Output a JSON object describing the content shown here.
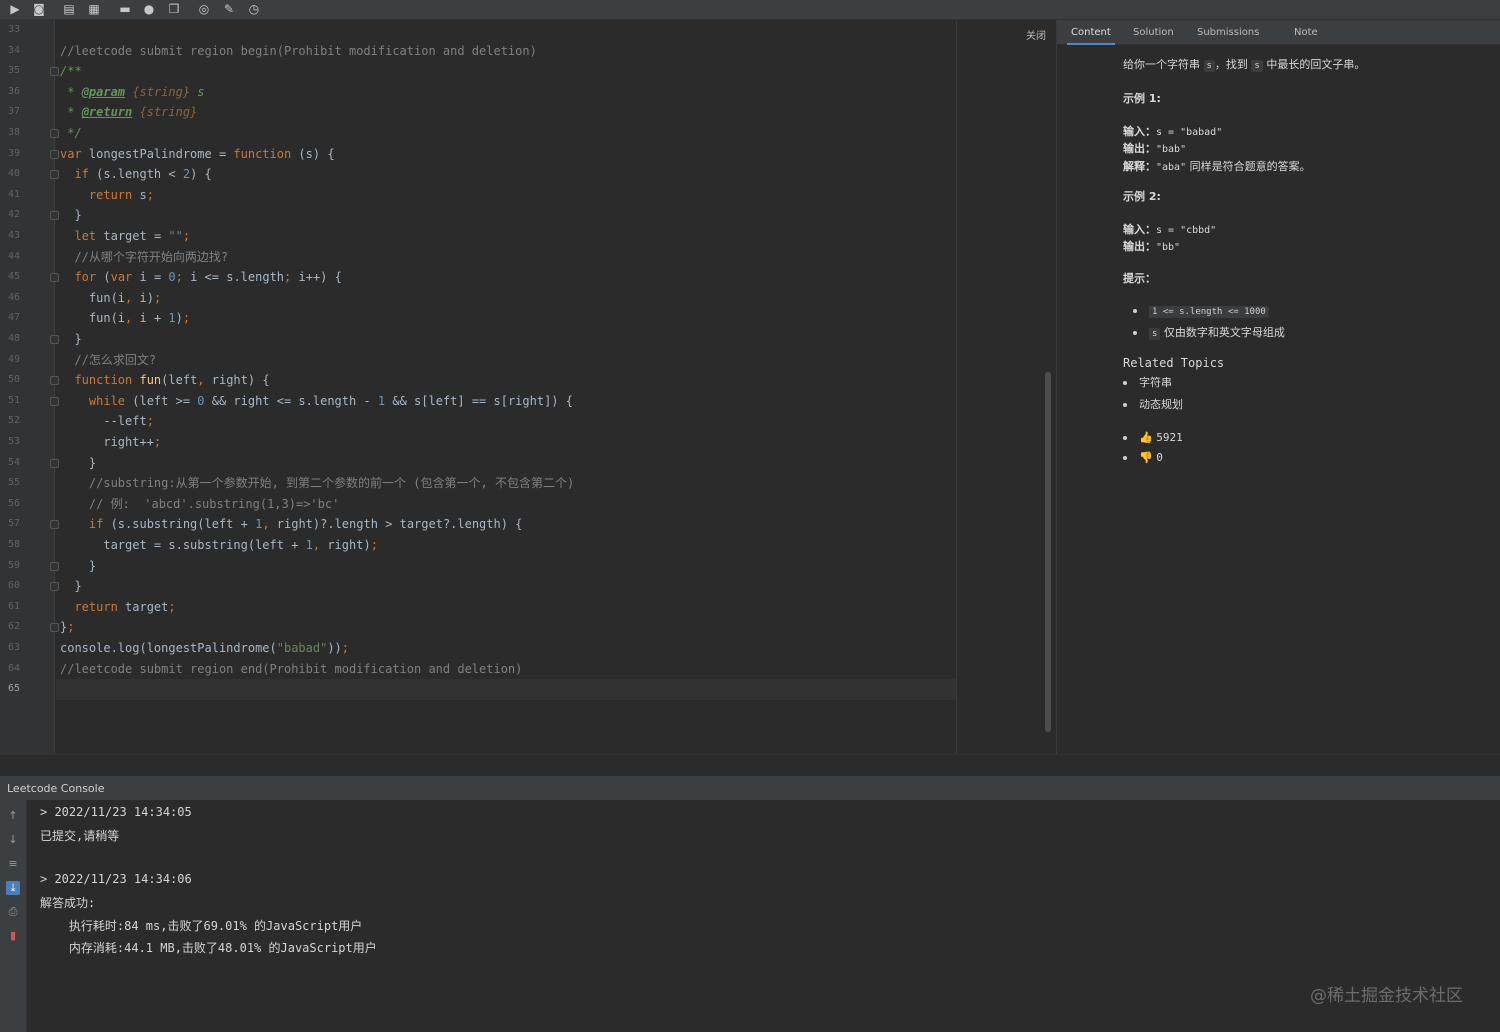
{
  "toolbar": {
    "icons": [
      "run-icon",
      "debug-icon",
      "submit-icon",
      "test-icon",
      "comment-icon",
      "hint-icon",
      "copy-icon",
      "position-icon",
      "edit-icon",
      "timer-icon"
    ]
  },
  "editor": {
    "close_label": "关闭",
    "current_line": "65",
    "lines": [
      {
        "n": "33",
        "html": ""
      },
      {
        "n": "34",
        "html": "<span class='cm'>//leetcode submit region begin(Prohibit modification and deletion)</span>"
      },
      {
        "n": "35",
        "html": "<span class='doc'>/**</span>"
      },
      {
        "n": "36",
        "html": "<span class='doc'> * </span><span class='doctag'>@param</span><span class='doctype'> {string}</span><span class='doc'> s</span>"
      },
      {
        "n": "37",
        "html": "<span class='doc'> * </span><span class='doctag'>@return</span><span class='doctype'> {string}</span>"
      },
      {
        "n": "38",
        "html": "<span class='doc'> */</span>"
      },
      {
        "n": "39",
        "html": "<span class='kw'>var</span> longestPalindrome = <span class='kw'>function</span> (s) {"
      },
      {
        "n": "40",
        "html": "  <span class='kw'>if</span> (s.length &lt; <span class='num'>2</span>) {"
      },
      {
        "n": "41",
        "html": "    <span class='kw'>return</span> s<span class='kw'>;</span>"
      },
      {
        "n": "42",
        "html": "  }"
      },
      {
        "n": "43",
        "html": "  <span class='kw'>let</span> target = <span class='str'>\"\"</span><span class='kw'>;</span>"
      },
      {
        "n": "44",
        "html": "  <span class='cm'>//从哪个字符开始向两边找?</span>"
      },
      {
        "n": "45",
        "html": "  <span class='kw'>for</span> (<span class='kw'>var</span> i = <span class='num'>0</span><span class='kw'>;</span> i &lt;= s.length<span class='kw'>;</span> i++) {"
      },
      {
        "n": "46",
        "html": "    fun(i<span class='kw'>,</span> i)<span class='kw'>;</span>"
      },
      {
        "n": "47",
        "html": "    fun(i<span class='kw'>,</span> i + <span class='num'>1</span>)<span class='kw'>;</span>"
      },
      {
        "n": "48",
        "html": "  }"
      },
      {
        "n": "49",
        "html": "  <span class='cm'>//怎么求回文?</span>"
      },
      {
        "n": "50",
        "html": "  <span class='kw'>function</span> <span class='fn'>fun</span>(left<span class='kw'>,</span> right) {"
      },
      {
        "n": "51",
        "html": "    <span class='kw'>while</span> (left &gt;= <span class='num'>0</span> &amp;&amp; right &lt;= s.length - <span class='num'>1</span> &amp;&amp; s[left] == s[right]) {"
      },
      {
        "n": "52",
        "html": "      --left<span class='kw'>;</span>"
      },
      {
        "n": "53",
        "html": "      right++<span class='kw'>;</span>"
      },
      {
        "n": "54",
        "html": "    }"
      },
      {
        "n": "55",
        "html": "    <span class='cm'>//substring:从第一个参数开始, 到第二个参数的前一个 (包含第一个, 不包含第二个)</span>"
      },
      {
        "n": "56",
        "html": "    <span class='cm'>// 例:  'abcd'.substring(1,3)=>'bc'</span>"
      },
      {
        "n": "57",
        "html": "    <span class='kw'>if</span> (s.substring(left + <span class='num'>1</span><span class='kw'>,</span> right)?.length &gt; target?.length) {"
      },
      {
        "n": "58",
        "html": "      target = s.substring(left + <span class='num'>1</span><span class='kw'>,</span> right)<span class='kw'>;</span>"
      },
      {
        "n": "59",
        "html": "    }"
      },
      {
        "n": "60",
        "html": "  }"
      },
      {
        "n": "61",
        "html": "  <span class='kw'>return</span> target<span class='kw'>;</span>"
      },
      {
        "n": "62",
        "html": "}<span class='kw'>;</span>"
      },
      {
        "n": "63",
        "html": "console.log(longestPalindrome(<span class='str'>\"babad\"</span>))<span class='kw'>;</span>"
      },
      {
        "n": "64",
        "html": "<span class='cm'>//leetcode submit region end(Prohibit modification and deletion)</span>"
      },
      {
        "n": "65",
        "html": ""
      }
    ]
  },
  "panel": {
    "tabs": [
      {
        "label": "Content",
        "active": true
      },
      {
        "label": "Solution",
        "active": false
      },
      {
        "label": "Submissions",
        "active": false
      },
      {
        "label": "Note",
        "active": false
      }
    ],
    "content": {
      "intro_1": "给你一个字符串 ",
      "intro_code_1": "s",
      "intro_2": "，找到 ",
      "intro_code_2": "s",
      "intro_3": " 中最长的回文子串。",
      "example1_title": "示例 1:",
      "ex1_input_label": "输入：",
      "ex1_input_value": "s = \"babad\"",
      "ex1_output_label": "输出：",
      "ex1_output_value": "\"bab\"",
      "ex1_explain_label": "解释：",
      "ex1_explain_value_code": "\"aba\"",
      "ex1_explain_value_text": " 同样是符合题意的答案。",
      "example2_title": "示例 2:",
      "ex2_input_label": "输入：",
      "ex2_input_value": "s = \"cbbd\"",
      "ex2_output_label": "输出：",
      "ex2_output_value": "\"bb\"",
      "hints_title": "提示：",
      "hint1_code": "1 <= s.length <= 1000",
      "hint2_code": "s",
      "hint2_text": " 仅由数字和英文字母组成",
      "related_title": "Related Topics",
      "topics": [
        "字符串",
        "动态规划"
      ],
      "likes": "5921",
      "dislikes": "0"
    }
  },
  "console": {
    "title": "Leetcode Console",
    "lines": [
      "> 2022/11/23 14:34:05",
      "已提交,请稍等",
      "",
      "> 2022/11/23 14:34:06",
      "解答成功:",
      "    执行耗时:84 ms,击败了69.01% 的JavaScript用户",
      "    内存消耗:44.1 MB,击败了48.01% 的JavaScript用户"
    ]
  },
  "watermark": "@稀土掘金技术社区"
}
